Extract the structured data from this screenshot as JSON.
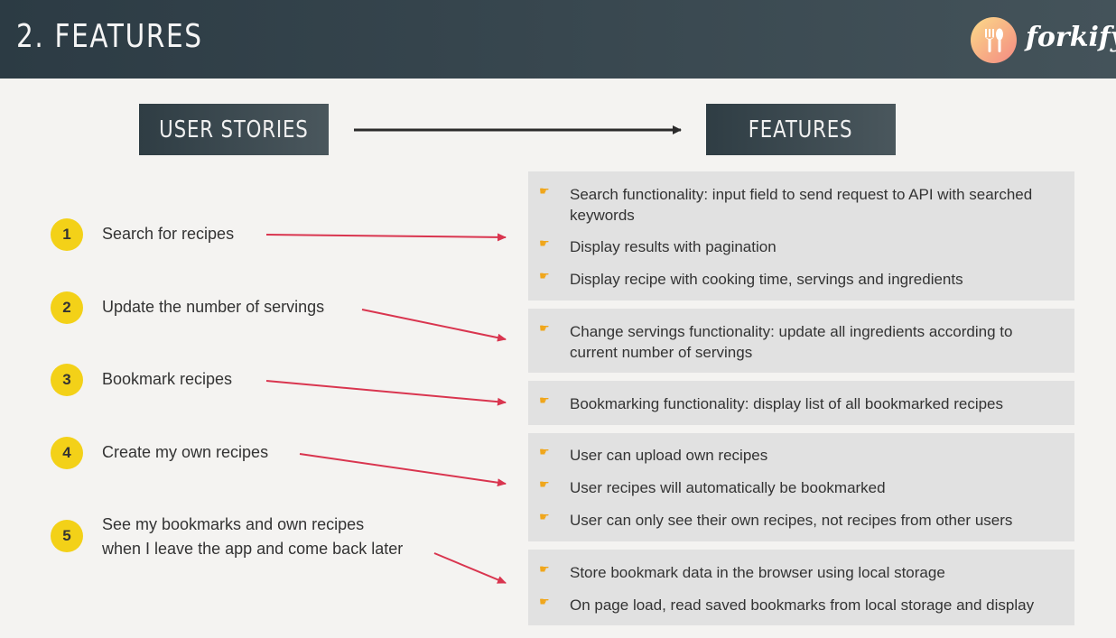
{
  "header": {
    "title": "2. FEATURES",
    "logo_text": "forkify",
    "logo_icon": "fork-knife-icon"
  },
  "labels": {
    "user_stories": "USER STORIES",
    "features": "FEATURES"
  },
  "stories": [
    {
      "number": "1",
      "text": "Search for recipes"
    },
    {
      "number": "2",
      "text": "Update the number of servings"
    },
    {
      "number": "3",
      "text": "Bookmark recipes"
    },
    {
      "number": "4",
      "text": "Create my own recipes"
    },
    {
      "number": "5",
      "line1": "See my bookmarks and own recipes",
      "line2": "when I leave the app and come back later"
    }
  ],
  "features": [
    {
      "items": [
        {
          "line1": "Search functionality: input field to send request to API with searched",
          "line2": "keywords"
        },
        {
          "line1": "Display results with pagination"
        },
        {
          "line1": "Display recipe with cooking time, servings and ingredients"
        }
      ]
    },
    {
      "items": [
        {
          "line1": "Change servings functionality: update all ingredients according to",
          "line2": "current number of servings"
        }
      ]
    },
    {
      "items": [
        {
          "line1": "Bookmarking functionality: display list of all bookmarked recipes"
        }
      ]
    },
    {
      "items": [
        {
          "line1": "User can upload own recipes"
        },
        {
          "line1": "User recipes will automatically be bookmarked"
        },
        {
          "line1": "User can only see their own recipes, not recipes from other users"
        }
      ]
    },
    {
      "items": [
        {
          "line1": "Store bookmark data in the browser using local storage"
        },
        {
          "line1": "On page load, read saved bookmarks from local storage and display"
        }
      ]
    }
  ],
  "colors": {
    "number_badge": "#f3d118",
    "arrow_red": "#d9354f",
    "bullet_hand": "#f0a61b"
  }
}
